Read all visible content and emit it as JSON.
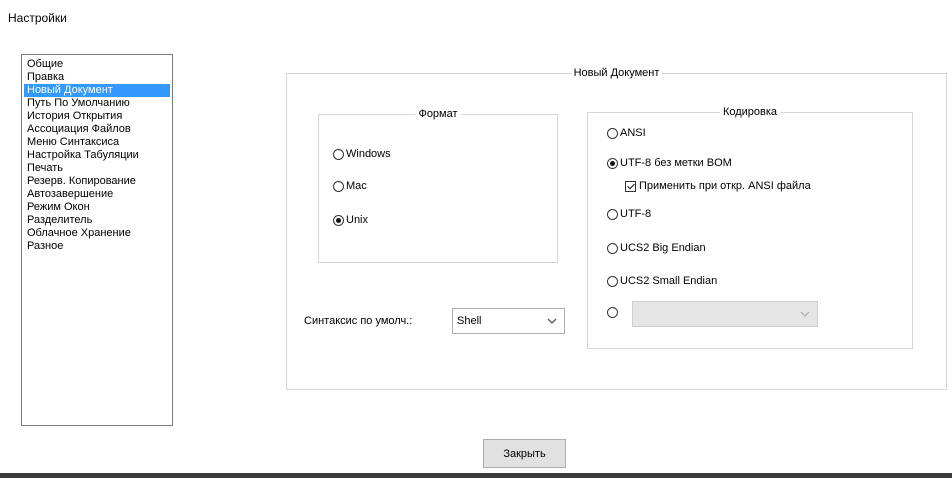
{
  "window": {
    "title": "Настройки"
  },
  "sidebar": {
    "items": [
      {
        "label": "Общие"
      },
      {
        "label": "Правка"
      },
      {
        "label": "Новый Документ",
        "selected": true
      },
      {
        "label": "Путь По Умолчанию"
      },
      {
        "label": "История Открытия"
      },
      {
        "label": "Ассоциация Файлов"
      },
      {
        "label": "Меню Синтаксиса"
      },
      {
        "label": "Настройка Табуляции"
      },
      {
        "label": "Печать"
      },
      {
        "label": "Резерв. Копирование"
      },
      {
        "label": "Автозавершение"
      },
      {
        "label": "Режим Окон"
      },
      {
        "label": "Разделитель"
      },
      {
        "label": "Облачное Хранение"
      },
      {
        "label": "Разное"
      }
    ],
    "selected_color": "#3399ff"
  },
  "new_document": {
    "group_title": "Новый Документ",
    "format": {
      "group_title": "Формат",
      "options": [
        {
          "label": "Windows",
          "checked": false
        },
        {
          "label": "Mac",
          "checked": false
        },
        {
          "label": "Unix",
          "checked": true
        }
      ]
    },
    "encoding": {
      "group_title": "Кодировка",
      "options": [
        {
          "label": "ANSI",
          "checked": false
        },
        {
          "label": "UTF-8 без метки BOM",
          "checked": true
        },
        {
          "label": "UTF-8",
          "checked": false
        },
        {
          "label": "UCS2 Big Endian",
          "checked": false
        },
        {
          "label": "UCS2 Small Endian",
          "checked": false
        },
        {
          "label": "",
          "checked": false
        }
      ],
      "apply_ansi_checkbox": {
        "label": "Применить при откр. ANSI файла",
        "checked": true
      },
      "other_encoding_combo": {
        "value": "",
        "disabled": true
      }
    },
    "default_syntax": {
      "label": "Синтаксис по умолч.:",
      "value": "Shell"
    }
  },
  "footer": {
    "close_label": "Закрыть"
  }
}
